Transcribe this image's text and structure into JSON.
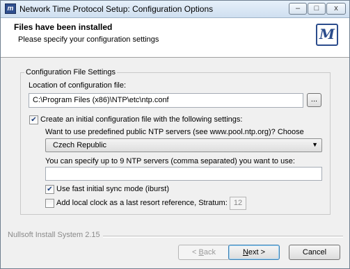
{
  "window": {
    "title": "Network Time Protocol Setup: Configuration Options",
    "app_icon_glyph": "m",
    "minimize_glyph": "–",
    "maximize_glyph": "□",
    "close_glyph": "x"
  },
  "header": {
    "title": "Files have been installed",
    "subtitle": "Please specify your configuration settings",
    "logo_glyph": "M"
  },
  "group": {
    "title": "Configuration File Settings",
    "location_label": "Location of configuration file:",
    "location_value": "C:\\Program Files (x86)\\NTP\\etc\\ntp.conf",
    "browse_label": "...",
    "create_config": {
      "label": "Create an initial configuration file with the following settings:",
      "checked": true
    },
    "predefined_label": "Want to use predefined public NTP servers (see www.pool.ntp.org)? Choose",
    "country_select": {
      "value": "Czech Republic",
      "arrow": "▼"
    },
    "servers_label": "You can specify up to 9 NTP servers (comma separated) you want to use:",
    "servers_value": "",
    "iburst": {
      "label": "Use fast initial sync mode (iburst)",
      "checked": true
    },
    "local_clock": {
      "label": "Add local clock as a last resort reference, Stratum:",
      "checked": false
    },
    "stratum_value": "12"
  },
  "footer": {
    "branding": "Nullsoft Install System 2.15",
    "back_label": "< Back",
    "back_underline": "B",
    "next_label": "Next >",
    "next_underline": "N",
    "cancel_label": "Cancel"
  },
  "icons": {
    "check": "✔"
  }
}
